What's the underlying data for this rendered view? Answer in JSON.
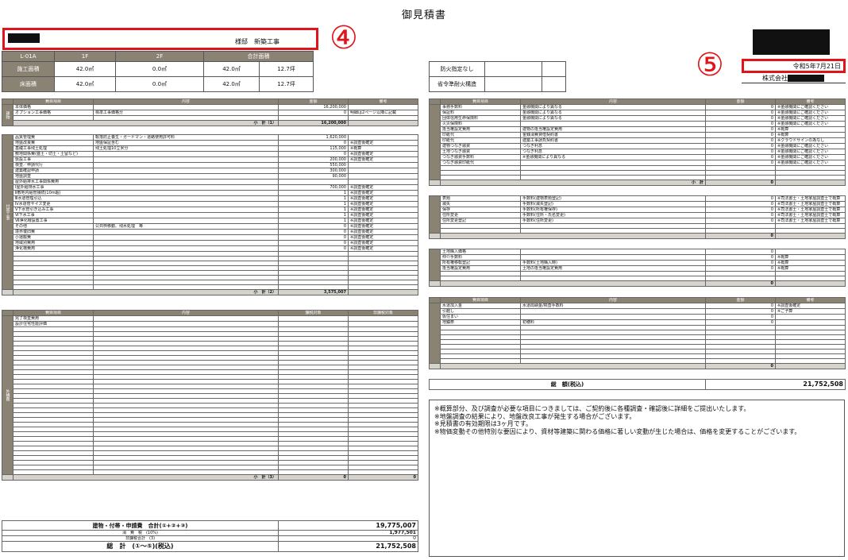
{
  "doc_title": "御見積書",
  "customer": {
    "suffix": "様邸　新築工事"
  },
  "markers": {
    "four": "④",
    "five": "⑤"
  },
  "issuer": {
    "date": "令和5年7月21日",
    "company_prefix": "株式会社"
  },
  "area_table": {
    "headers": [
      "L-01A",
      "1F",
      "2F",
      "合計面積"
    ],
    "rows": [
      {
        "label": "施工面積",
        "f1": "42.0㎡",
        "f2": "0.0㎡",
        "total": "42.0㎡",
        "tsubo": "12.7坪"
      },
      {
        "label": "床面積",
        "f1": "42.0㎡",
        "f2": "0.0㎡",
        "total": "42.0㎡",
        "tsubo": "12.7坪"
      }
    ]
  },
  "fire_table": {
    "row1": "防火指定なし",
    "row2": "省令準耐火構造"
  },
  "section1": {
    "headers": [
      "費目項目",
      "内容",
      "金額",
      "備考"
    ],
    "side": "建物",
    "rows": [
      {
        "item": "本体価格",
        "content": "",
        "amount": "16,200,000",
        "note": ""
      },
      {
        "item": "オプション工事価格",
        "content": "標準工事価格分",
        "amount": "0",
        "note": "明細は2ページ以降に記載"
      }
    ],
    "subtotal_label": "小　計（1）",
    "subtotal": "16,200,000"
  },
  "section2": {
    "side": "付帯工事",
    "rows": [
      {
        "item": "品質管理費",
        "content": "転落防止養生・ガードマン・道路使用許可料",
        "amount": "1,620,000",
        "note": ""
      },
      {
        "item": "地盤改良費",
        "content": "地盤保証含む",
        "amount": "0",
        "note": "※調査後確定"
      },
      {
        "item": "基礎工事残土処理",
        "content": "残土処理10立米分",
        "amount": "115,000",
        "note": "※概算"
      },
      {
        "item": "敷地関係費(盛土・切土・土留など)",
        "content": "",
        "amount": "0",
        "note": "※調査後確定"
      },
      {
        "item": "仮設工事",
        "content": "",
        "amount": "200,000",
        "note": "※調査後確定"
      },
      {
        "item": "検査／申請代行",
        "content": "",
        "amount": "550,000",
        "note": ""
      },
      {
        "item": "建築確認申請",
        "content": "",
        "amount": "300,000",
        "note": ""
      },
      {
        "item": "地盤調査",
        "content": "",
        "amount": "90,000",
        "note": ""
      },
      {
        "item": "屋外給排水工事関係費用",
        "content": "",
        "amount": "",
        "note": ""
      },
      {
        "item": "Ⅰ屋外給排水工事",
        "content": "",
        "amount": "700,000",
        "note": "※調査後確定"
      },
      {
        "item": "Ⅱ敷地内給管接続(10m超)",
        "content": "",
        "amount": "1",
        "note": "※調査後確定"
      },
      {
        "item": "Ⅲ水道管理引込",
        "content": "",
        "amount": "1",
        "note": "※調査後確定"
      },
      {
        "item": "Ⅳ水道管サイズ変更",
        "content": "",
        "amount": "1",
        "note": "※調査後確定"
      },
      {
        "item": "Ⅴ下水管引き込み工事",
        "content": "",
        "amount": "1",
        "note": "※調査後確定"
      },
      {
        "item": "Ⅵ下水工事",
        "content": "",
        "amount": "1",
        "note": "※調査後確定"
      },
      {
        "item": "Ⅶ浄化槽設置工事",
        "content": "",
        "amount": "1",
        "note": "※調査後確定"
      },
      {
        "item": "その他",
        "content": "公共桝移動、残水処理　等",
        "amount": "0",
        "note": "※調査後確定"
      },
      {
        "item": "境界復旧費",
        "content": "",
        "amount": "0",
        "note": "※調査後確定"
      },
      {
        "item": "小運搬費",
        "content": "",
        "amount": "0",
        "note": "※調査後確定"
      },
      {
        "item": "地域別費用",
        "content": "",
        "amount": "0",
        "note": "※調査後確定"
      },
      {
        "item": "浄化槽費用",
        "content": "",
        "amount": "0",
        "note": "※調査後確定"
      }
    ],
    "subtotal_label": "小　計（2）",
    "subtotal": "3,575,007"
  },
  "section3": {
    "headers": [
      "費目項目",
      "内容",
      "課税対象",
      "非課税対象"
    ],
    "side": "外構費",
    "rows": [
      {
        "item": "完了検査費用",
        "content": ""
      },
      {
        "item": "設計住宅性能評価",
        "content": ""
      }
    ],
    "subtotal_label": "小　計（3）",
    "subtotal_a": "0",
    "subtotal_b": "0"
  },
  "totals": {
    "line1_label": "建物・付帯・申請費　合計(①+②+③)",
    "line1_value": "19,775,007",
    "line2_label": "消　費　税　(10%)",
    "line2_value": "1,977,501",
    "line3_label": "非課税合計　(3)",
    "line3_value": "0",
    "grand_label": "総　計　(①〜⑤)(税込)",
    "grand_value": "21,752,508"
  },
  "right1": {
    "headers": [
      "費目項目",
      "内容",
      "金額",
      "備考"
    ],
    "rows": [
      {
        "item": "事務手数料",
        "content": "金融機関により異なる",
        "amount": "0",
        "note": "※金融機関にご確認ください"
      },
      {
        "item": "保証料",
        "content": "金融機関により異なる",
        "amount": "0",
        "note": "※金融機関にご確認ください"
      },
      {
        "item": "団体信用生命保険料",
        "content": "金融機関により異なる",
        "amount": "0",
        "note": "※金融機関にご確認ください"
      },
      {
        "item": "火災保険料",
        "content": "",
        "amount": "0",
        "note": "※金融機関にご確認ください"
      },
      {
        "item": "抵当権設定費用",
        "content": "建物の抵当権設定費用",
        "amount": "0",
        "note": "※概算"
      },
      {
        "item": "印紙代",
        "content": "金銭消費貸借契約書",
        "amount": "0",
        "note": "※概算"
      },
      {
        "item": "印紙代",
        "content": "建築工事請負契約書",
        "amount": "0",
        "note": "※クラウドサインの為なし"
      },
      {
        "item": "建物つなぎ融資",
        "content": "つなぎ利息",
        "amount": "0",
        "note": "※金融機関にご確認ください"
      },
      {
        "item": "土地つなぎ融資",
        "content": "つなぎ利息",
        "amount": "0",
        "note": "※金融機関にご確認ください"
      },
      {
        "item": "つなぎ融資手数料",
        "content": "※金融機関により異なる",
        "amount": "0",
        "note": "※金融機関にご確認ください"
      },
      {
        "item": "つなぎ融資印紙代",
        "content": "",
        "amount": "0",
        "note": "※金融機関にご確認ください"
      }
    ],
    "subtotal_label": "小　計",
    "subtotal": "0"
  },
  "right2": {
    "rows": [
      {
        "item": "表題",
        "content": "手数料(建物表題登記)",
        "amount": "0",
        "note": "※司法書士・土地家屋調査士で概算"
      },
      {
        "item": "滅失",
        "content": "手数料(滅失登記)",
        "amount": "0",
        "note": "※司法書士・土地家屋調査士で概算"
      },
      {
        "item": "保存",
        "content": "手数料(所有権保存)",
        "amount": "0",
        "note": "※司法書士・土地家屋調査士で概算"
      },
      {
        "item": "住所変更",
        "content": "手数料(住所・氏名変更)",
        "amount": "0",
        "note": "※司法書士・土地家屋調査士で概算"
      },
      {
        "item": "住所変更登記",
        "content": "手数料(住所変更)",
        "amount": "0",
        "note": "※司法書士・土地家屋調査士で概算"
      }
    ],
    "subtotal": "0"
  },
  "right3": {
    "rows": [
      {
        "item": "土地購入価格",
        "content": "",
        "amount": "0",
        "note": ""
      },
      {
        "item": "仲介手数料",
        "content": "",
        "amount": "0",
        "note": "※概算"
      },
      {
        "item": "所有権移転登記",
        "content": "手数料(土地購入時)",
        "amount": "0",
        "note": "※概算"
      },
      {
        "item": "抵当権設定費用",
        "content": "土地の抵当権設定費用",
        "amount": "0",
        "note": "※概算"
      }
    ],
    "subtotal": "0"
  },
  "right4": {
    "rows": [
      {
        "item": "水道加入金",
        "content": "水道局納金/検査手数料",
        "amount": "0",
        "note": "※調査後確定"
      },
      {
        "item": "引越し",
        "content": "",
        "amount": "0",
        "note": "※ご予算"
      },
      {
        "item": "仮住まい",
        "content": "",
        "amount": "0",
        "note": ""
      },
      {
        "item": "地鎮祭",
        "content": "初穂料",
        "amount": "0",
        "note": ""
      }
    ],
    "subtotal": "0"
  },
  "right_total": {
    "label": "総　額(税込)",
    "value": "21,752,508"
  },
  "notes": [
    "※概算部分、及び調査が必要な項目につきましては、ご契約後に各種調査・確認後に詳細をご提出いたします。",
    "※地盤調査の結果により、地盤改良工事が発生する場合がございます。",
    "※見積書の有効期限は3ヶ月です。",
    "※物価変動その他特別な要因により、資材等建築に関わる価格に著しい変動が生じた場合は、価格を変更することがございます。"
  ]
}
